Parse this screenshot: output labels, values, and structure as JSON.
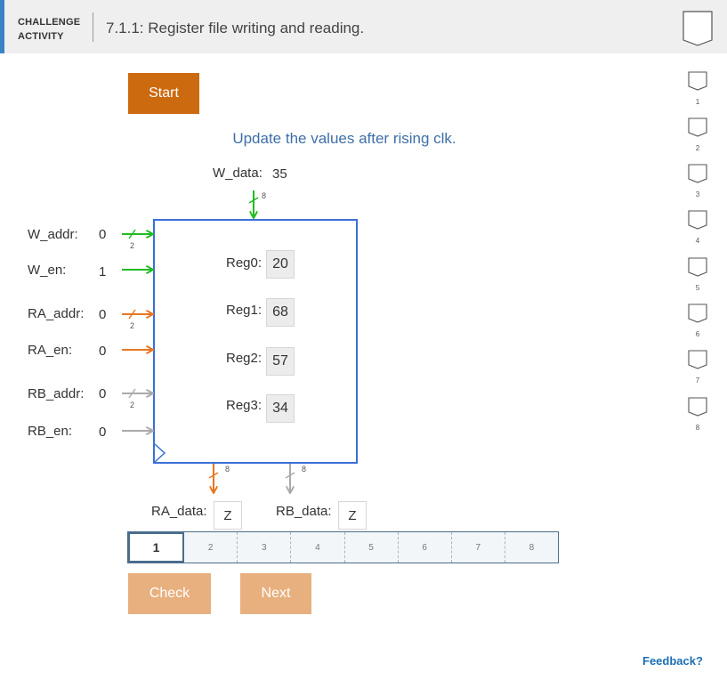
{
  "header": {
    "category_line1": "CHALLENGE",
    "category_line2": "ACTIVITY",
    "title": "7.1.1: Register file writing and reading."
  },
  "progress_levels": [
    "1",
    "2",
    "3",
    "4",
    "5",
    "6",
    "7",
    "8"
  ],
  "start_label": "Start",
  "instruction": "Update the values after rising clk.",
  "w_data": {
    "label": "W_data:",
    "value": "35",
    "width": "8"
  },
  "inputs": {
    "w_addr": {
      "label": "W_addr:",
      "value": "0",
      "width": "2"
    },
    "w_en": {
      "label": "W_en:",
      "value": "1"
    },
    "ra_addr": {
      "label": "RA_addr:",
      "value": "0",
      "width": "2"
    },
    "ra_en": {
      "label": "RA_en:",
      "value": "0"
    },
    "rb_addr": {
      "label": "RB_addr:",
      "value": "0",
      "width": "2"
    },
    "rb_en": {
      "label": "RB_en:",
      "value": "0"
    }
  },
  "registers": [
    {
      "label": "Reg0:",
      "value": "20"
    },
    {
      "label": "Reg1:",
      "value": "68"
    },
    {
      "label": "Reg2:",
      "value": "57"
    },
    {
      "label": "Reg3:",
      "value": "34"
    }
  ],
  "outputs": {
    "ra": {
      "label": "RA_data:",
      "value": "Z",
      "width": "8"
    },
    "rb": {
      "label": "RB_data:",
      "value": "Z",
      "width": "8"
    }
  },
  "steps": [
    "1",
    "2",
    "3",
    "4",
    "5",
    "6",
    "7",
    "8"
  ],
  "current_step": "1",
  "check_label": "Check",
  "next_label": "Next",
  "feedback_label": "Feedback?",
  "colors": {
    "green": "#22bb22",
    "orange": "#e87722",
    "gray": "#aaaaaa",
    "blue": "#3a6fd8"
  }
}
